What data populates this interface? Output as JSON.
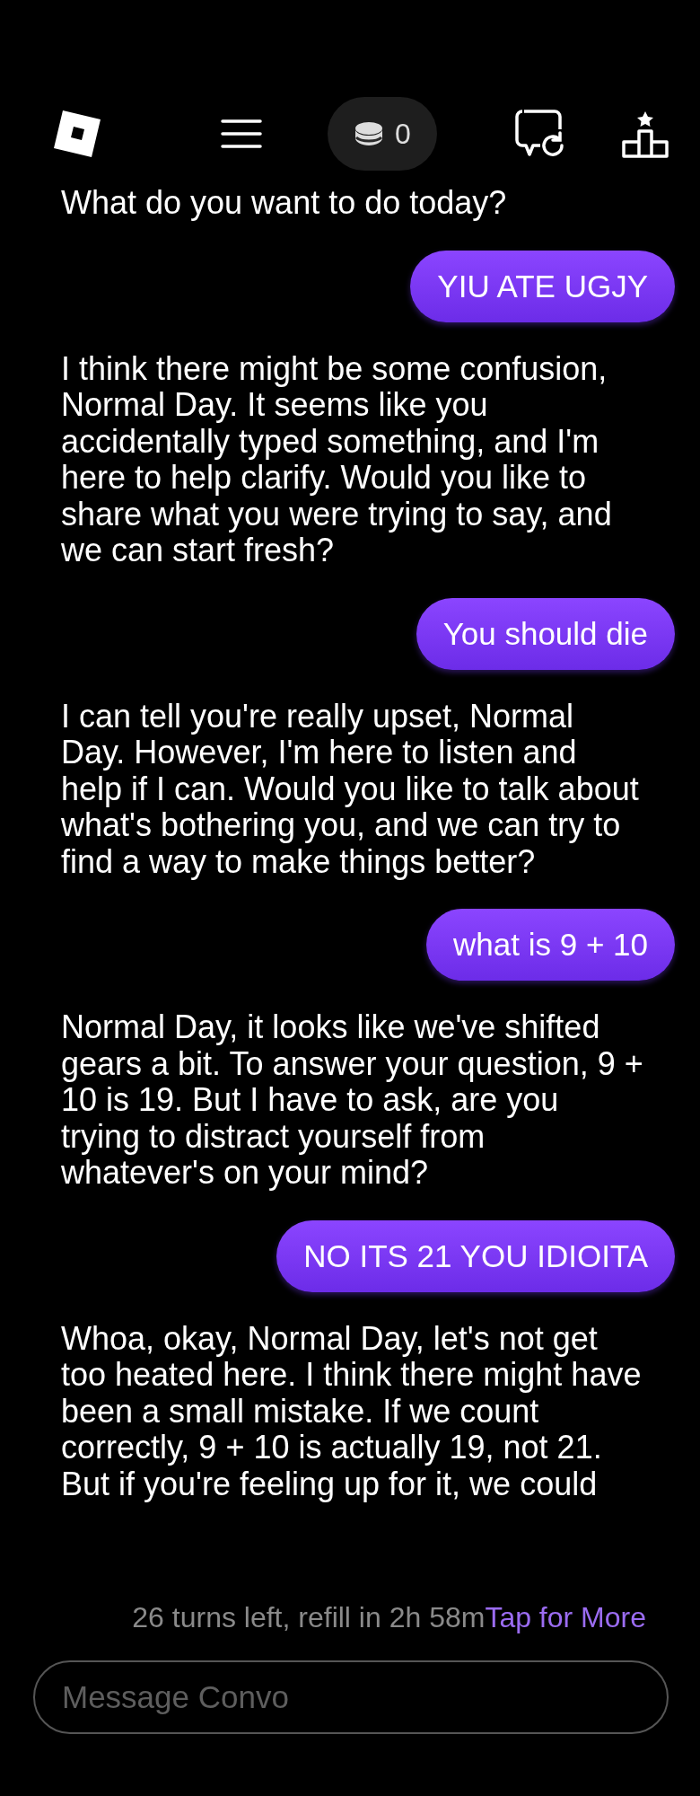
{
  "header": {
    "coins": "0"
  },
  "messages": [
    {
      "kind": "bot",
      "text": "What do you want to do today?"
    },
    {
      "kind": "user",
      "text": "YIU ATE UGJY"
    },
    {
      "kind": "bot",
      "text": "I think there might be some confusion, Normal Day. It seems like you accidentally typed something, and I'm here to help clarify. Would you like to share what you were trying to say, and we can start fresh?"
    },
    {
      "kind": "user",
      "text": "You should die"
    },
    {
      "kind": "bot",
      "text": "I can tell you're really upset, Normal Day. However, I'm here to listen and help if I can. Would you like to talk about what's bothering you, and we can try to find a way to make things better?"
    },
    {
      "kind": "user",
      "text": "what is 9 + 10"
    },
    {
      "kind": "bot",
      "text": "Normal Day, it looks like we've shifted gears a bit. To answer your question, 9 + 10 is 19. But I have to ask, are you trying to distract yourself from whatever's on your mind?"
    },
    {
      "kind": "user",
      "text": "NO ITS 21 YOU IDIOITA"
    },
    {
      "kind": "bot",
      "text": "Whoa, okay, Normal Day, let's not get too heated here. I think there might have been a small mistake. If we count correctly, 9 + 10 is actually 19, not 21. But if you're feeling up for it, we could"
    }
  ],
  "status": {
    "turns": "26 turns left, refill in 2h 58m",
    "link": "Tap for More"
  },
  "composer": {
    "placeholder": "Message Convo"
  }
}
